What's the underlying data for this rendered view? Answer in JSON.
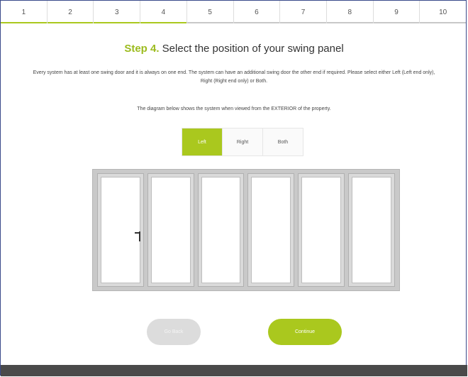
{
  "steps": [
    "1",
    "2",
    "3",
    "4",
    "5",
    "6",
    "7",
    "8",
    "9",
    "10"
  ],
  "current_step": 4,
  "heading": {
    "step_label": "Step 4.",
    "text": "Select the position of your swing panel"
  },
  "description": "Every system has at least one swing door and it is always on one end. The system can have an additional swing door the other end if required. Please select either Left (Left end only), Right (Right end only) or Both.",
  "note": "The diagram below shows the system when viewed from the EXTERIOR of the property.",
  "options": [
    {
      "label": "Left",
      "selected": true
    },
    {
      "label": "Right",
      "selected": false
    },
    {
      "label": "Both",
      "selected": false
    }
  ],
  "diagram": {
    "panel_count": 6,
    "handle_on_panel": 1
  },
  "buttons": {
    "back": "Go Back",
    "continue": "Continue"
  },
  "colors": {
    "accent": "#aac81e",
    "frame": "#c9c9c9",
    "footer": "#4a4a4a"
  }
}
